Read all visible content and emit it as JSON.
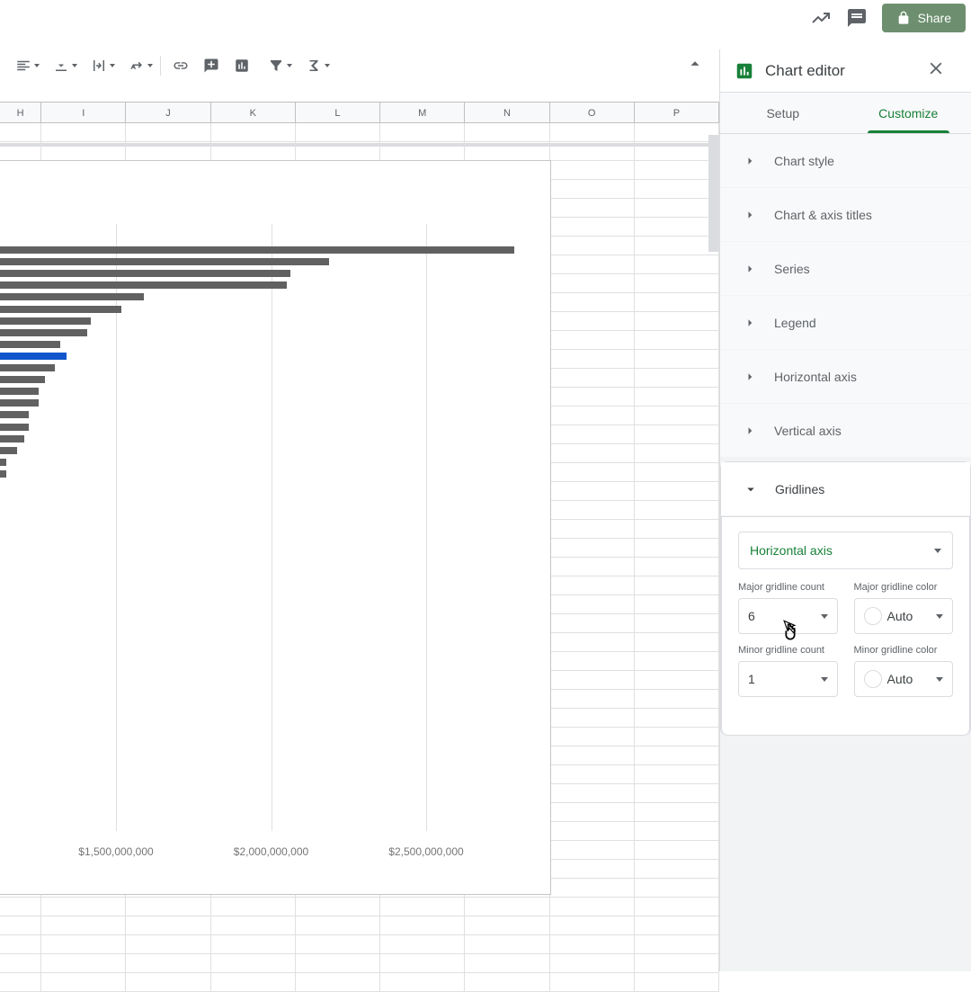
{
  "header": {
    "share_label": "Share"
  },
  "columns": [
    "H",
    "I",
    "J",
    "K",
    "L",
    "M",
    "N",
    "O",
    "P"
  ],
  "panel": {
    "title": "Chart editor",
    "tabs": {
      "setup": "Setup",
      "customize": "Customize"
    },
    "sections": {
      "chart_style": "Chart style",
      "chart_axis_titles": "Chart & axis titles",
      "series": "Series",
      "legend": "Legend",
      "horizontal_axis": "Horizontal axis",
      "vertical_axis": "Vertical axis",
      "gridlines": "Gridlines"
    },
    "gridlines": {
      "axis_select": "Horizontal axis",
      "major_count_label": "Major gridline count",
      "major_count_value": "6",
      "major_color_label": "Major gridline color",
      "major_color_value": "Auto",
      "minor_count_label": "Minor gridline count",
      "minor_count_value": "1",
      "minor_color_label": "Minor gridline color",
      "minor_color_value": "Auto"
    }
  },
  "chart_data": {
    "type": "bar",
    "xlabel": "",
    "ylabel": "",
    "x_axis_ticks": [
      "$1,500,000,000",
      "$2,000,000,000",
      "$2,500,000,000"
    ],
    "x_tick_positions": [
      172,
      344.5,
      517
    ],
    "highlight_index": 9,
    "values": [
      615,
      409,
      366,
      362,
      203,
      178,
      144,
      140,
      110,
      117,
      104,
      93,
      86,
      86,
      75,
      75,
      70,
      62,
      50,
      50
    ]
  }
}
